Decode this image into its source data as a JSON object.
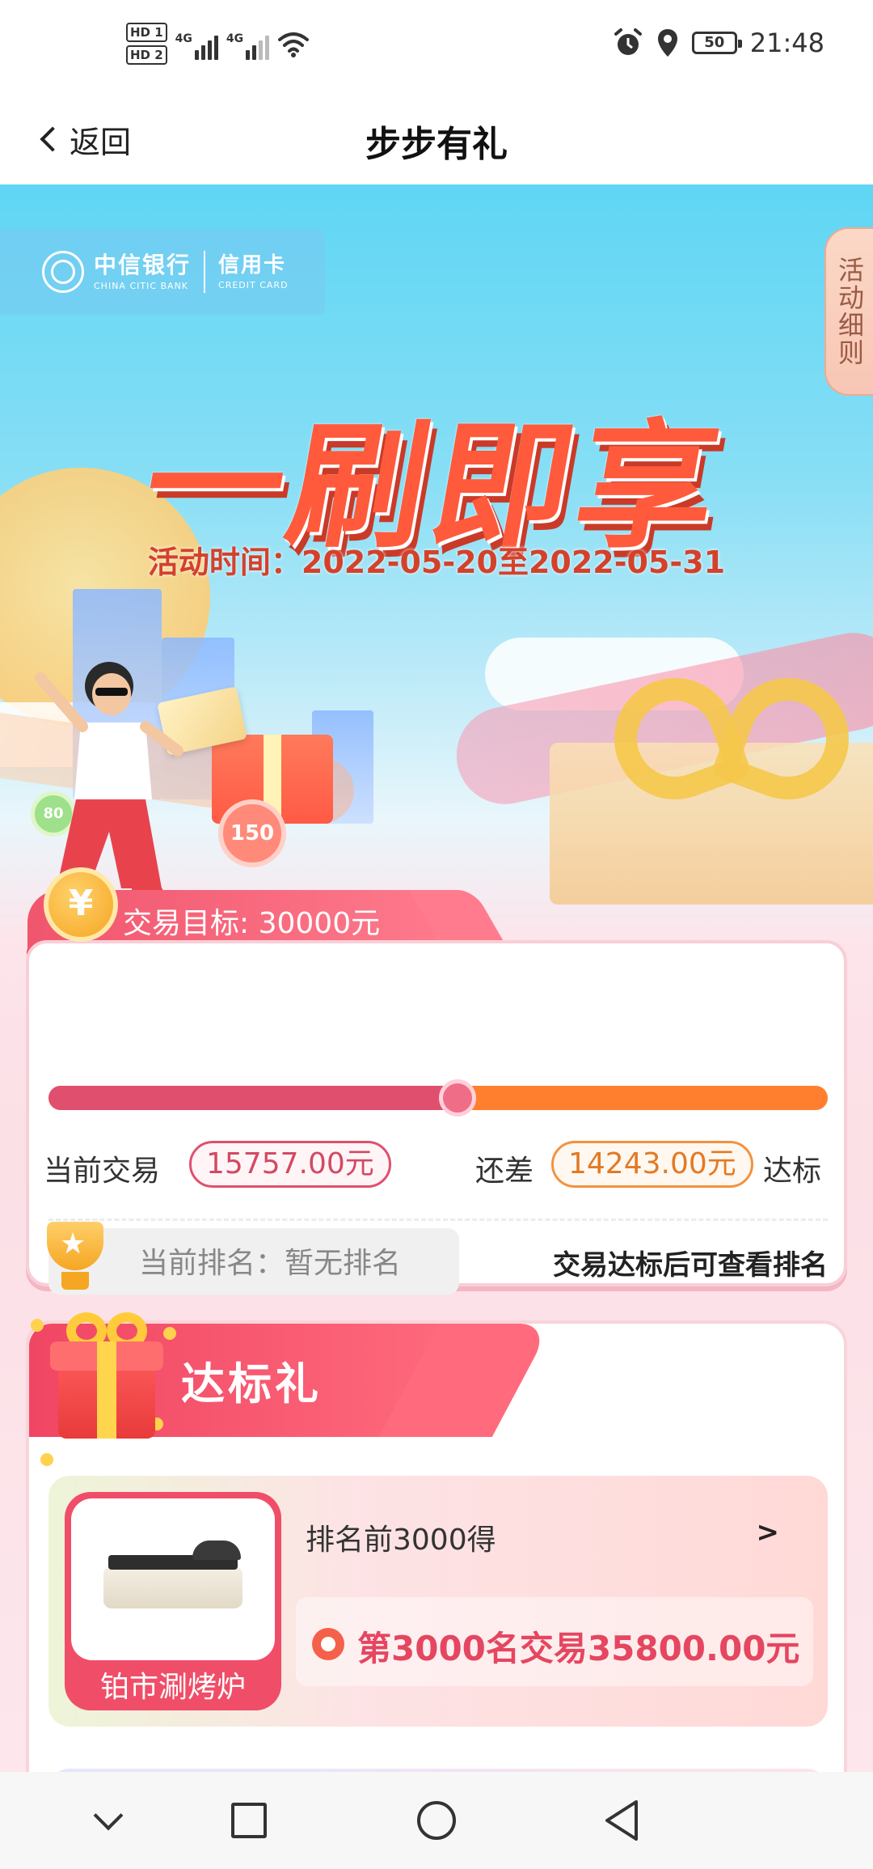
{
  "status_bar": {
    "hd1": "HD 1",
    "hd2": "HD 2",
    "net1": "4G",
    "net2": "4G",
    "battery": "50",
    "time": "21:48",
    "icons": [
      "alarm-icon",
      "location-icon",
      "wifi-icon",
      "signal-icon",
      "battery-icon"
    ]
  },
  "nav": {
    "back_label": "返回",
    "title": "步步有礼"
  },
  "banner": {
    "bank_name_cn": "中信银行",
    "bank_name_en": "CHINA CITIC BANK",
    "card_cn": "信用卡",
    "card_en": "CREDIT CARD",
    "rules_tab": "活动细则",
    "headline": "一刷即享",
    "activity_time": "活动时间：2022-05-20至2022-05-31",
    "deco_badge_1": "150",
    "deco_badge_2": "80"
  },
  "target": {
    "coin_symbol": "¥",
    "label": "交易目标: 30000元",
    "progress_fraction": 0.525,
    "current_label": "当前交易",
    "current_value": "15757.00元",
    "gap_label": "还差",
    "gap_value": "14243.00元",
    "gap_suffix": "达标",
    "rank_label": "当前排名：暂无排名",
    "rank_hint": "交易达标后可查看排名",
    "colors": {
      "progress_done": "#e0506e",
      "progress_remaining": "#ff7f2e"
    }
  },
  "reward": {
    "title": "达标礼",
    "prizes": [
      {
        "name": "铂市涮烤炉",
        "rule": "排名前3000得",
        "arrow": ">",
        "condition": "第3000名交易35800.00元"
      }
    ]
  },
  "system_nav": {
    "icons": [
      "chevron-down-icon",
      "square-icon",
      "circle-icon",
      "triangle-back-icon"
    ]
  }
}
